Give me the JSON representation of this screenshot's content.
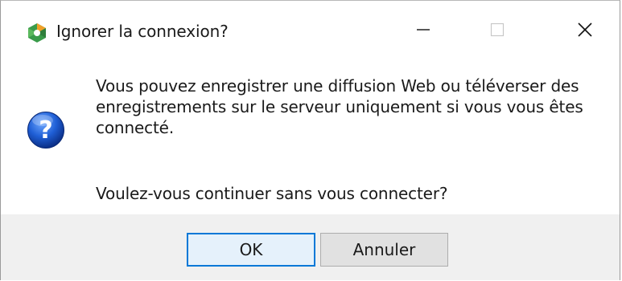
{
  "window": {
    "title": "Ignorer la connexion?",
    "controls": {
      "minimize": "minimize-icon",
      "maximize": "maximize-icon",
      "close": "close-icon"
    }
  },
  "icons": {
    "app": "app-logo-icon",
    "question": "question-icon"
  },
  "message": {
    "line1": "Vous pouvez enregistrer une diffusion Web ou téléverser des",
    "line2": "enregistrements sur le serveur uniquement si vous vous êtes",
    "line3": "connecté.",
    "line4": "Voulez-vous continuer sans vous connecter?"
  },
  "buttons": {
    "ok": "OK",
    "cancel": "Annuler"
  },
  "colors": {
    "accent": "#0078d7",
    "footer_bg": "#f0f0f0",
    "button_bg": "#e1e1e1",
    "default_button_bg": "#e5f1fb"
  }
}
